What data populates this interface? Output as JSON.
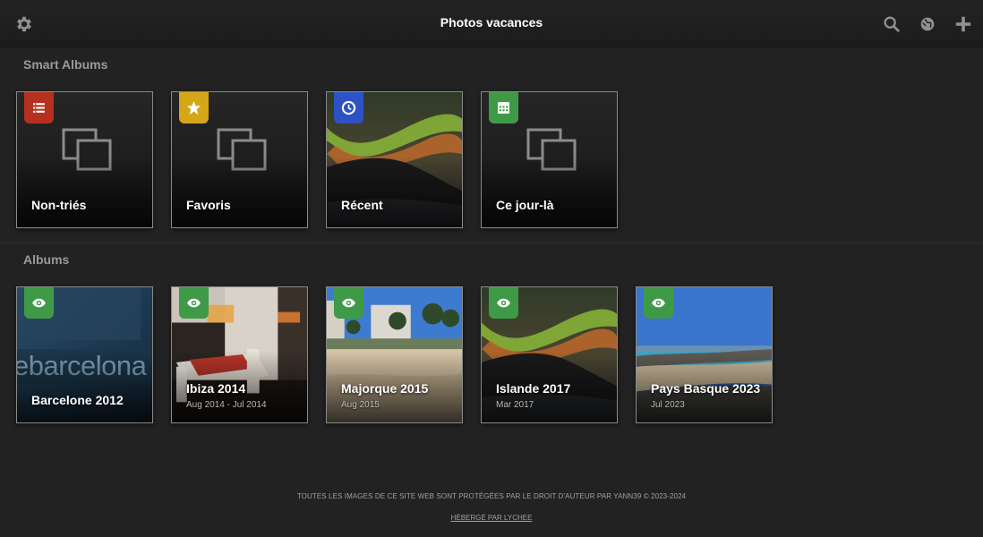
{
  "header": {
    "title": "Photos vacances",
    "icons": [
      "gear-icon",
      "search-icon",
      "globe-icon",
      "plus-icon"
    ]
  },
  "smart_albums": {
    "title": "Smart Albums",
    "items": [
      {
        "name": "Non-triés",
        "badge_icon": "list-icon",
        "badge_color": "#b5301e"
      },
      {
        "name": "Favoris",
        "badge_icon": "star-icon",
        "badge_color": "#d6a619"
      },
      {
        "name": "Récent",
        "badge_icon": "clock-icon",
        "badge_color": "#2d52c6"
      },
      {
        "name": "Ce jour-là",
        "badge_icon": "calendar-icon",
        "badge_color": "#3f9a47"
      }
    ]
  },
  "albums": {
    "title": "Albums",
    "items": [
      {
        "name": "Barcelone 2012",
        "date": "",
        "badge_icon": "eye-icon",
        "thumb_text": "ebarcelona"
      },
      {
        "name": "Ibiza 2014",
        "date": "Aug 2014 - Jul 2014",
        "badge_icon": "eye-icon"
      },
      {
        "name": "Majorque 2015",
        "date": "Aug 2015",
        "badge_icon": "eye-icon"
      },
      {
        "name": "Islande 2017",
        "date": "Mar 2017",
        "badge_icon": "eye-icon"
      },
      {
        "name": "Pays Basque 2023",
        "date": "Jul 2023",
        "badge_icon": "eye-icon"
      }
    ],
    "badge_color": "#3f9a47"
  },
  "footer": {
    "copyright": "TOUTES LES IMAGES DE CE SITE WEB SONT PROTÉGÉES PAR LE DROIT D'AUTEUR PAR YANN39 © 2023-2024",
    "hosted": "HÉBERGÉ PAR LYCHEE"
  }
}
